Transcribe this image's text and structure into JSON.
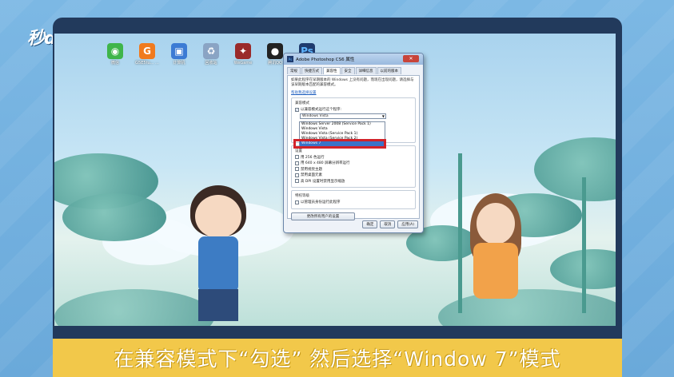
{
  "brand": {
    "logo_text": "秒d⚪ng视频"
  },
  "desktop": {
    "icons": [
      {
        "name": "wechat-icon",
        "label": "微信",
        "color": "#3fb54a",
        "glyph": "◉"
      },
      {
        "name": "app-icon",
        "label": "G5E5tu...\n...",
        "color": "#f07a1e",
        "glyph": "G"
      },
      {
        "name": "computer-icon",
        "label": "计算机",
        "color": "#3c7bd4",
        "glyph": "▣"
      },
      {
        "name": "recycle-bin-icon",
        "label": "回收站",
        "color": "#8aa4c4",
        "glyph": "♻"
      },
      {
        "name": "game-icon",
        "label": "WeGame",
        "color": "#9a2a2a",
        "glyph": "✦"
      },
      {
        "name": "qq-icon",
        "label": "腾讯QQ",
        "color": "#222222",
        "glyph": "●"
      },
      {
        "name": "photoshop-icon",
        "label": "Ps",
        "color": "#1f3b6e",
        "glyph": "Ps"
      }
    ]
  },
  "dialog": {
    "title": "Adobe Photoshop CS6 属性",
    "close_label": "✕",
    "tabs": [
      "常规",
      "快捷方式",
      "兼容性",
      "安全",
      "详细信息",
      "以前的版本"
    ],
    "active_tab": "兼容性",
    "description": "如果此程序在早期版本的 Windows 上没有问题，而现在出现问题，请选择与该早期版本匹配的兼容模式。",
    "help_link": "帮助我选择设置",
    "compat_group_title": "兼容模式",
    "compat_checkbox_label": "以兼容模式运行这个程序:",
    "compat_checked": true,
    "selected_os": "Windows Vista",
    "dropdown_options": [
      "Windows Server 2008 (Service Pack 1)",
      "Windows Vista",
      "Windows Vista (Service Pack 1)",
      "Windows Vista (Service Pack 2)",
      "Windows 7"
    ],
    "dropdown_selected_index": 4,
    "settings_group_title": "设置",
    "settings": [
      "用 256 色运行",
      "用 640 x 480 屏幕分辨率运行",
      "禁用视觉主题",
      "禁用桌面元素",
      "高 DPI 设置时禁用显示缩放"
    ],
    "privilege_group_title": "特权等级",
    "privilege_label": "以管理员身份运行此程序",
    "change_all_users_label": "更改所有用户的设置",
    "ok_label": "确定",
    "cancel_label": "取消",
    "apply_label": "应用(A)"
  },
  "caption": {
    "text": "在兼容模式下“勾选” 然后选择“Window 7”模式"
  },
  "colors": {
    "highlight_box": "#d2232a",
    "caption_bg": "#f2c84a",
    "monitor_frame": "#223a5c"
  }
}
